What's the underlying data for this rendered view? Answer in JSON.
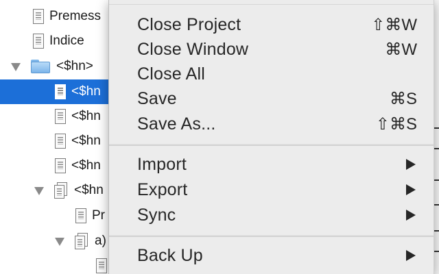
{
  "binder": {
    "items": [
      {
        "label": "Premess",
        "kind": "doc",
        "indent": 0
      },
      {
        "label": "Indice",
        "kind": "doc",
        "indent": 0
      },
      {
        "label": "<$hn>",
        "kind": "folder",
        "indent": 0,
        "expanded": true
      },
      {
        "label": "<$hn",
        "kind": "doc",
        "indent": 1,
        "selected": true
      },
      {
        "label": "<$hn",
        "kind": "doc",
        "indent": 1
      },
      {
        "label": "<$hn",
        "kind": "doc",
        "indent": 1
      },
      {
        "label": "<$hn",
        "kind": "doc",
        "indent": 1
      },
      {
        "label": "<$hn",
        "kind": "stack",
        "indent": 1,
        "expanded": true
      },
      {
        "label": "Pr",
        "kind": "doc",
        "indent": 2
      },
      {
        "label": "a)",
        "kind": "stack",
        "indent": 2,
        "expanded": true
      },
      {
        "label": "",
        "kind": "doc",
        "indent": 3
      }
    ]
  },
  "menu": {
    "groups": [
      [
        {
          "label": "Close Project",
          "shortcut": "⇧⌘W"
        },
        {
          "label": "Close Window",
          "shortcut": "⌘W"
        },
        {
          "label": "Close All",
          "shortcut": ""
        },
        {
          "label": "Save",
          "shortcut": "⌘S"
        },
        {
          "label": "Save As...",
          "shortcut": "⇧⌘S"
        }
      ],
      [
        {
          "label": "Import",
          "submenu": true
        },
        {
          "label": "Export",
          "submenu": true
        },
        {
          "label": "Sync",
          "submenu": true
        }
      ],
      [
        {
          "label": "Back Up",
          "submenu": true
        }
      ]
    ]
  },
  "colors": {
    "selection": "#1c6fd8",
    "menu_bg": "#ececec",
    "folder": "#7db5ea"
  }
}
